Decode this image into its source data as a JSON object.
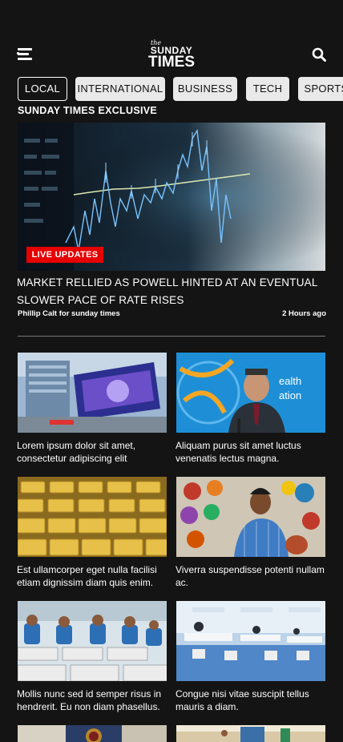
{
  "header": {
    "logo_the": "the",
    "logo_sunday": "SUNDAY",
    "logo_times": "TIMES"
  },
  "tabs": [
    {
      "label": "LOCAL",
      "active": true
    },
    {
      "label": "INTERNATIONAL",
      "active": false
    },
    {
      "label": "BUSINESS",
      "active": false
    },
    {
      "label": "TECH",
      "active": false
    },
    {
      "label": "SPORTS",
      "active": false
    }
  ],
  "featured": {
    "section_label": "SUNDAY TIMES EXCLUSIVE",
    "badge": "LIVE UPDATES",
    "title": "MARKET RELLIED AS POWELL HINTED AT AN EVENTUAL SLOWER PACE OF RATE RISES",
    "author": "Phillip Calt for sunday times",
    "time": "2 Hours ago"
  },
  "articles": [
    {
      "title": "Lorem ipsum dolor sit amet, consectetur adipiscing elit",
      "image": "bank-building-billboard"
    },
    {
      "title": "Aliquam purus sit amet luctus venenatis lectus magna.",
      "image": "who-press-conference"
    },
    {
      "title": "Est ullamcorper eget nulla facilisi etiam dignissim diam quis enim.",
      "image": "gold-bars"
    },
    {
      "title": "Viverra suspendisse potenti nullam ac.",
      "image": "mask-painter"
    },
    {
      "title": "Mollis nunc sed id semper risus in hendrerit. Eu non diam phasellus.",
      "image": "garment-factory"
    },
    {
      "title": "Congue nisi vitae suscipit tellus mauris a diam.",
      "image": "call-center-office"
    },
    {
      "title": "",
      "image": "government-emblem"
    },
    {
      "title": "",
      "image": "street-scene"
    }
  ],
  "icons": {
    "menu": "hamburger-menu-icon",
    "search": "search-icon"
  },
  "colors": {
    "background": "#141414",
    "badge": "#e60000",
    "tab_bg": "#e9e9e9"
  }
}
